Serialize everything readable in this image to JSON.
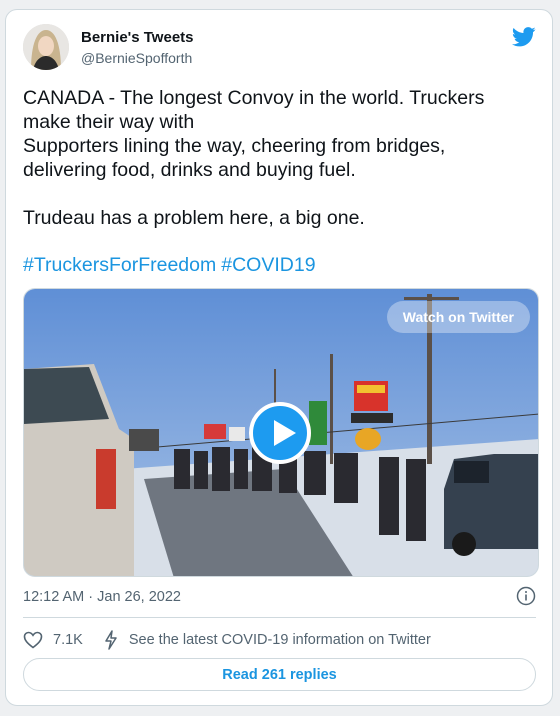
{
  "author": {
    "name": "Bernie's Tweets",
    "handle": "@BernieSpofforth"
  },
  "tweet": {
    "text": "CANADA - The longest Convoy in the world. Truckers make their way with\nSupporters lining the way, cheering from bridges, delivering food, drinks and buying fuel.\n\nTrudeau has a problem here, a big one.",
    "hashtags": [
      "#TruckersForFreedom",
      "#COVID19"
    ],
    "timestamp": "12:12 AM · Jan 26, 2022"
  },
  "media": {
    "watch_label": "Watch on Twitter"
  },
  "actions": {
    "likes": "7.1K",
    "info_label": "See the latest COVID-19 information on Twitter",
    "replies_label": "Read 261 replies"
  },
  "colors": {
    "brand": "#1d9bf0",
    "link": "#1b95e0",
    "muted": "#536471",
    "border": "#cfd9de"
  },
  "icons": [
    "twitter-bird-icon",
    "info-icon",
    "heart-icon",
    "lightning-icon",
    "play-icon"
  ]
}
